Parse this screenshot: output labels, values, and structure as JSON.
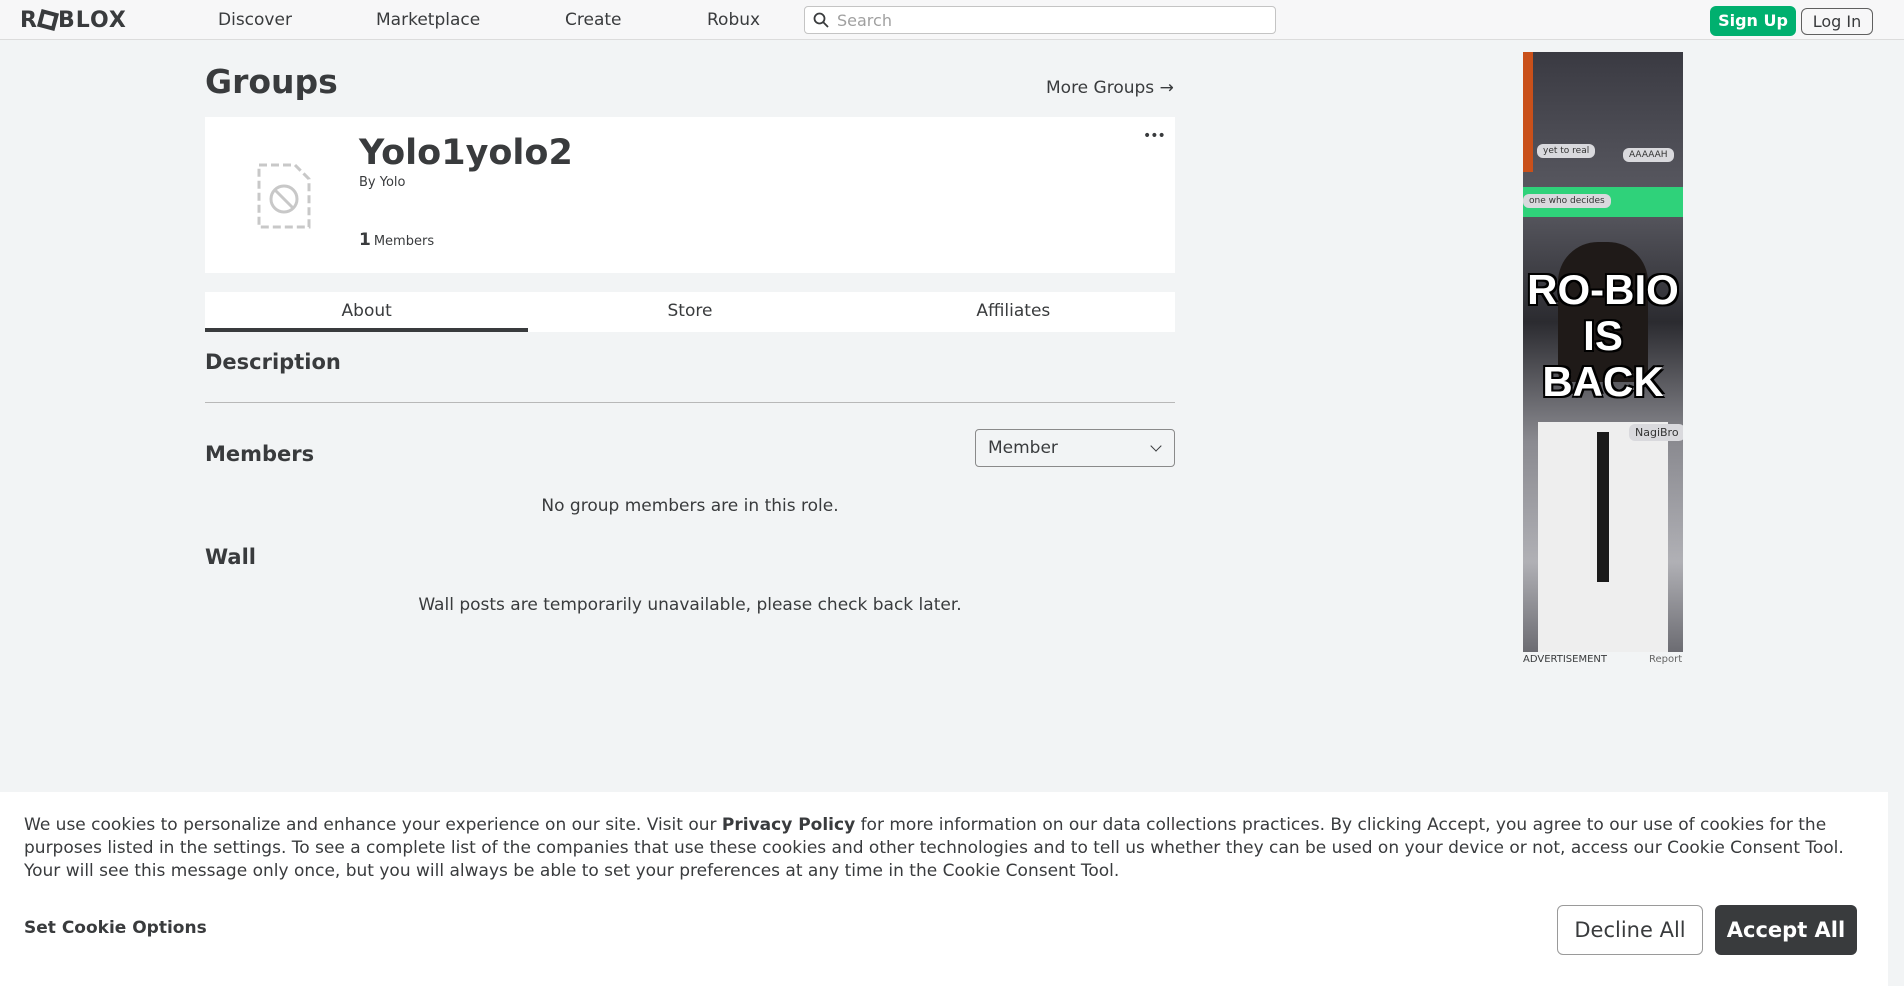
{
  "header": {
    "logo": "ROBLOX",
    "logo_parts": {
      "pre": "R",
      "post": "BLOX"
    },
    "nav": [
      "Discover",
      "Marketplace",
      "Create",
      "Robux"
    ],
    "search_placeholder": "Search",
    "signup_label": "Sign Up",
    "login_label": "Log In"
  },
  "page": {
    "title": "Groups",
    "more_groups": "More Groups →"
  },
  "group": {
    "name": "Yolo1yolo2",
    "by_prefix": "By",
    "owner": "Yolo",
    "member_count": "1",
    "members_label": "Members",
    "menu_icon": "•••"
  },
  "tabs": [
    "About",
    "Store",
    "Affiliates"
  ],
  "sections": {
    "description_title": "Description",
    "members_title": "Members",
    "role_selected": "Member",
    "members_empty": "No group members are in this role.",
    "wall_title": "Wall",
    "wall_message": "Wall posts are temporarily unavailable, please check back later."
  },
  "ad": {
    "headline_lines": [
      "RO-BIO",
      "IS",
      "BACK"
    ],
    "bubbles": [
      "yet to real",
      "AAAAAH",
      "one who decides",
      "NagiBro"
    ],
    "label": "ADVERTISEMENT",
    "report": "Report"
  },
  "cookie": {
    "text_before": "We use cookies to personalize and enhance your experience on our site. Visit our ",
    "privacy_link": "Privacy Policy",
    "text_after": " for more information on our data collections practices. By clicking Accept, you agree to our use of cookies for the purposes listed in the settings. To see a complete list of the companies that use these cookies and other technologies and to tell us whether they can be used on your device or not, access our Cookie Consent Tool. Your will see this message only once, but you will always be able to set your preferences at any time in the Cookie Consent Tool.",
    "set_options": "Set Cookie Options",
    "decline": "Decline All",
    "accept": "Accept All"
  },
  "colors": {
    "signup_green": "#00b06f",
    "accept_dark": "#393b3d",
    "page_bg": "#f2f4f5"
  }
}
